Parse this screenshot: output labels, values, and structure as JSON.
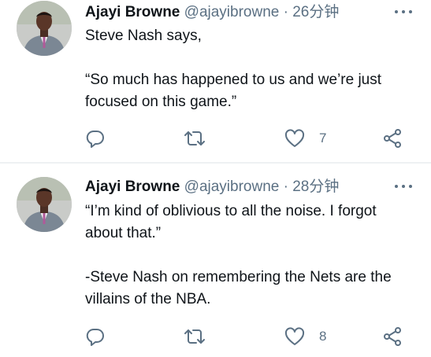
{
  "tweets": [
    {
      "author_name": "Ajayi Browne",
      "author_handle": "@ajayibrowne",
      "separator": "·",
      "time": "26分钟",
      "text": [
        "Steve Nash says,",
        "",
        "“So much has happened to us and we’re just focused on this game.”"
      ],
      "like_count": "7",
      "icons": {
        "more": "more-horizontal-icon",
        "reply": "reply-icon",
        "retweet": "retweet-icon",
        "like": "heart-icon",
        "share": "share-icon"
      }
    },
    {
      "author_name": "Ajayi Browne",
      "author_handle": "@ajayibrowne",
      "separator": "·",
      "time": "28分钟",
      "text": [
        "“I’m kind of oblivious to all the noise. I forgot about that.”",
        "",
        "-Steve Nash on remembering the Nets are the villains of the NBA."
      ],
      "like_count": "8",
      "icons": {
        "more": "more-horizontal-icon",
        "reply": "reply-icon",
        "retweet": "retweet-icon",
        "like": "heart-icon",
        "share": "share-icon"
      }
    }
  ],
  "colors": {
    "text": "#0f1419",
    "secondary": "#5b7083",
    "divider": "#eef1f3"
  }
}
